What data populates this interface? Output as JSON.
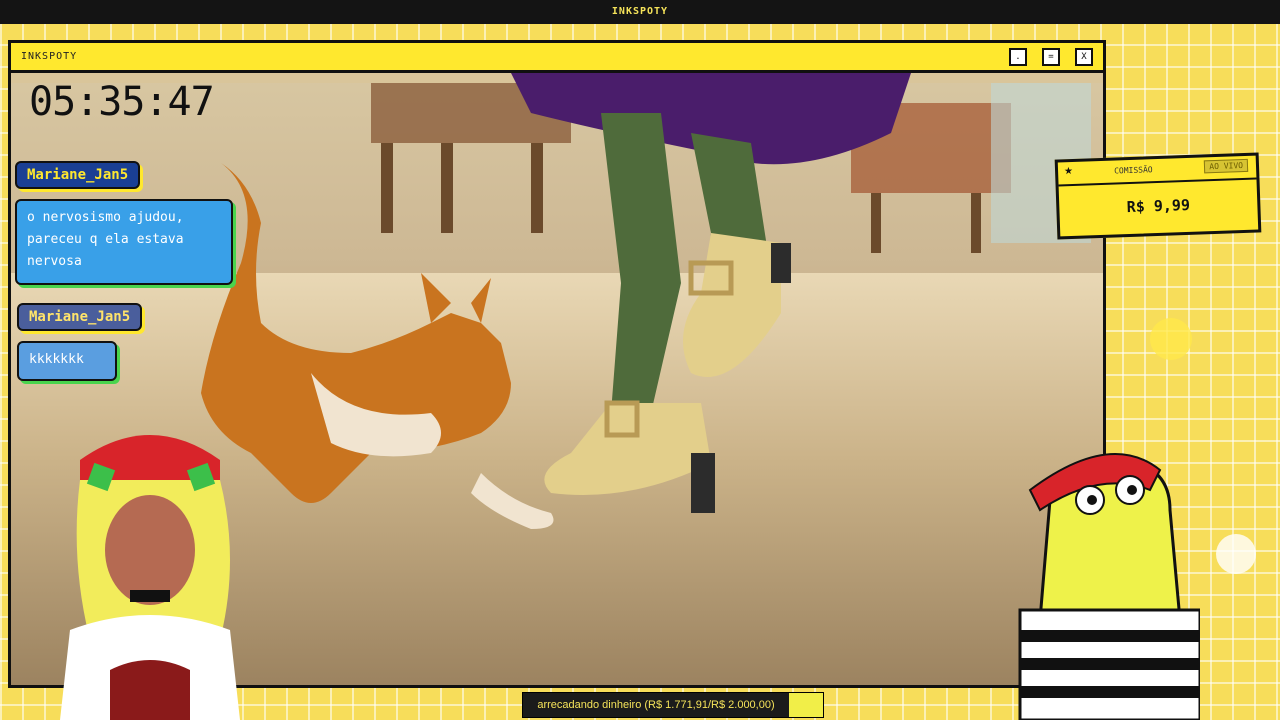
{
  "topbar": {
    "title": "INKSPOTY"
  },
  "window": {
    "title": "INKSPOTY",
    "buttons": {
      "minimize": ".",
      "maximize": "=",
      "close": "X"
    }
  },
  "overlay": {
    "timer": "05:35:47"
  },
  "chat": [
    {
      "user": "Mariane_Jan5",
      "message": "o nervosismo ajudou, pareceu q ela estava nervosa"
    },
    {
      "user": "Mariane_Jan5",
      "message": "kkkkkkk"
    }
  ],
  "commission": {
    "label": "COMISSÃO",
    "badge": "AO VIVO",
    "price": "R$ 9,99"
  },
  "goal": {
    "text": "arrecadando dinheiro (R$ 1.771,91/R$ 2.000,00)",
    "raised": 1771.91,
    "target": 2000.0,
    "progress": 0.886
  },
  "colors": {
    "accent": "#ffe82e",
    "chat_name_bg": "#1a3f94",
    "chat_msg_bg": "#39a0e8"
  },
  "icons": [
    "star-icon",
    "minimize-icon",
    "maximize-icon",
    "close-icon"
  ]
}
